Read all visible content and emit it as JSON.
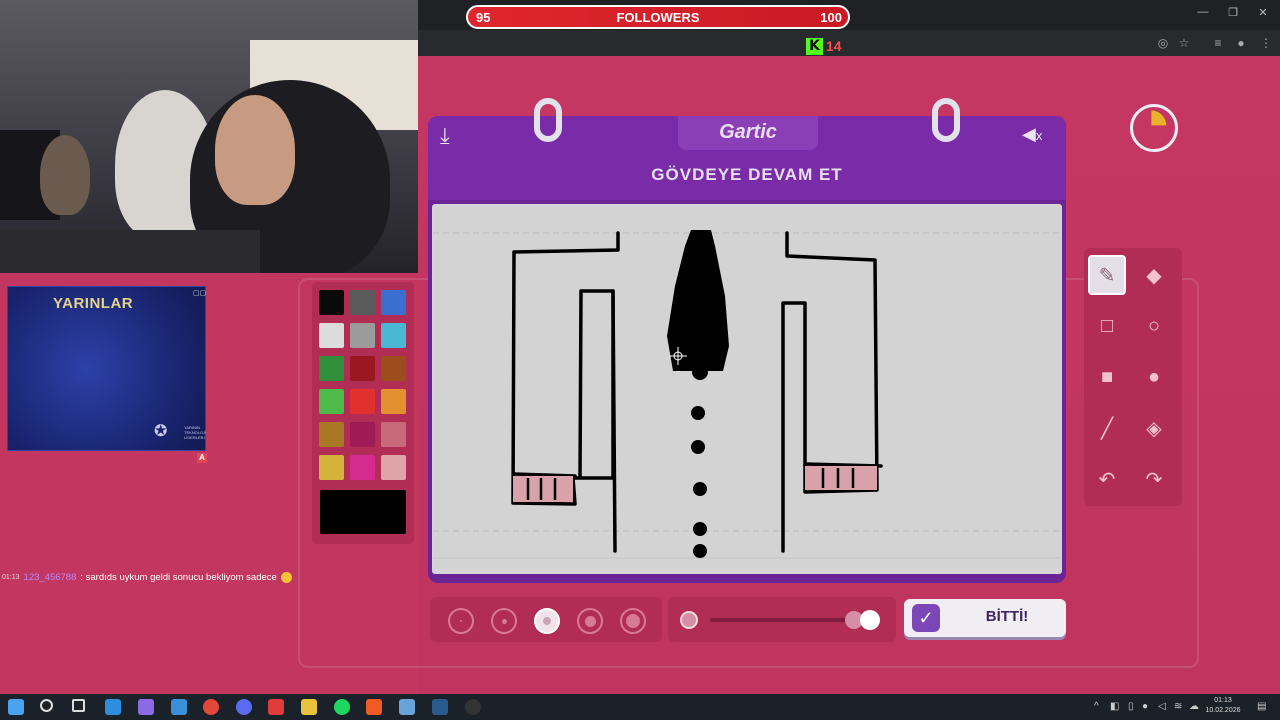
{
  "overlay": {
    "followers_label": "FOLLOWERS",
    "followers_current": "95",
    "followers_goal": "100",
    "kick_logo": "K",
    "kick_viewers": "14"
  },
  "promo": {
    "title": "YARINLAR",
    "footer": "YARININ TEKNOLOJİ LİDERLERİ",
    "badge": "A"
  },
  "chat": {
    "time": "01:13",
    "user": "123_456788",
    "message": ": sardıds uykum geldi sonucu bekliyom sadece"
  },
  "palette": {
    "colors": [
      "#0a0a0a",
      "#5a5a5a",
      "#3a6fcf",
      "#dcdcdc",
      "#9b9b9b",
      "#4ab8d4",
      "#2f8f3a",
      "#9c1820",
      "#9c4d1c",
      "#4cbb4a",
      "#e2302f",
      "#e39030",
      "#a87922",
      "#9e1b55",
      "#c86a7a",
      "#d4b23c",
      "#d52a8e",
      "#dfa3a8"
    ],
    "current": "#000000"
  },
  "game": {
    "logo": "Gartic",
    "instruction": "GÖVDEYE DEVAM ET",
    "done_label": "BİTTİ!",
    "mute_x": "x",
    "timer_elapsed_fraction": 0.25
  },
  "tools": [
    "pencil-icon",
    "eraser-icon",
    "rect-outline-icon",
    "ellipse-outline-icon",
    "rect-filled-icon",
    "ellipse-filled-icon",
    "line-icon",
    "fill-bucket-icon",
    "undo-icon",
    "redo-icon"
  ],
  "brush": {
    "sizes": 5,
    "selected_index": 2,
    "opacity_fraction": 0.85
  },
  "taskbar": {
    "time": "01:13",
    "date": "10.02.2026"
  },
  "colors": {
    "accent": "#6b2495",
    "background": "#c2365f",
    "panel": "#b12d55"
  }
}
